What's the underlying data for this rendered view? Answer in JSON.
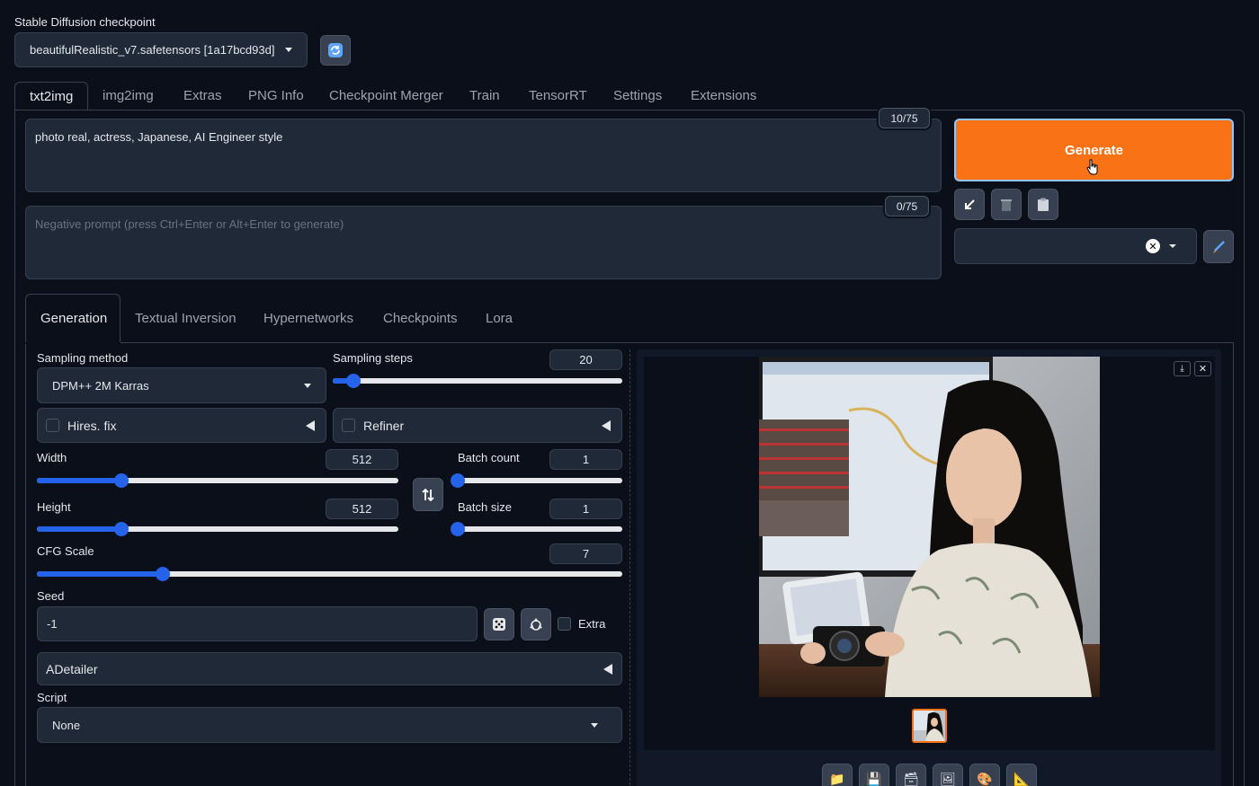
{
  "checkpoint": {
    "label": "Stable Diffusion checkpoint",
    "value": "beautifulRealistic_v7.safetensors [1a17bcd93d]"
  },
  "main_tabs": [
    {
      "label": "txt2img",
      "active": true
    },
    {
      "label": "img2img"
    },
    {
      "label": "Extras"
    },
    {
      "label": "PNG Info"
    },
    {
      "label": "Checkpoint Merger"
    },
    {
      "label": "Train"
    },
    {
      "label": "TensorRT"
    },
    {
      "label": "Settings"
    },
    {
      "label": "Extensions"
    }
  ],
  "prompt": {
    "value": "photo real, actress, Japanese, AI Engineer style",
    "counter": "10/75"
  },
  "negative_prompt": {
    "placeholder": "Negative prompt (press Ctrl+Enter or Alt+Enter to generate)",
    "counter": "0/75"
  },
  "generate": {
    "label": "Generate",
    "color": "#f97316"
  },
  "sub_tabs": [
    {
      "label": "Generation",
      "active": true
    },
    {
      "label": "Textual Inversion"
    },
    {
      "label": "Hypernetworks"
    },
    {
      "label": "Checkpoints"
    },
    {
      "label": "Lora"
    }
  ],
  "sampling_method": {
    "label": "Sampling method",
    "value": "DPM++ 2M Karras"
  },
  "sampling_steps": {
    "label": "Sampling steps",
    "value": "20",
    "fraction": 0.07
  },
  "hires_fix": {
    "label": "Hires. fix"
  },
  "refiner": {
    "label": "Refiner"
  },
  "width": {
    "label": "Width",
    "value": "512",
    "fraction": 0.235
  },
  "height": {
    "label": "Height",
    "value": "512",
    "fraction": 0.235
  },
  "batch_count": {
    "label": "Batch count",
    "value": "1",
    "fraction": 0.0
  },
  "batch_size": {
    "label": "Batch size",
    "value": "1",
    "fraction": 0.0
  },
  "cfg_scale": {
    "label": "CFG Scale",
    "value": "7",
    "fraction": 0.215
  },
  "seed": {
    "label": "Seed",
    "value": "-1",
    "extra_label": "Extra"
  },
  "adetailer": {
    "label": "ADetailer"
  },
  "script": {
    "label": "Script",
    "value": "None"
  },
  "accent": "#2563eb"
}
